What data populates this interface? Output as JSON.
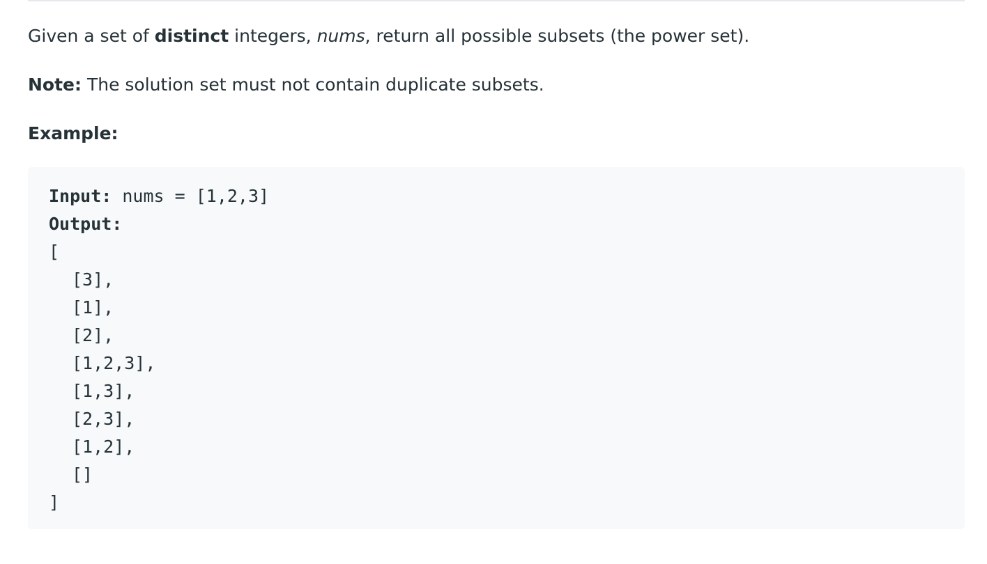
{
  "description": {
    "p1": {
      "prefix": "Given a set of ",
      "bold": "distinct",
      "middle": " integers, ",
      "italic": "nums",
      "suffix": ", return all possible subsets (the power set)."
    },
    "note": {
      "label": "Note:",
      "text": " The solution set must not contain duplicate subsets."
    },
    "example_heading": "Example:"
  },
  "example": {
    "input_label": "Input:",
    "input_value": " nums = [1,2,3]",
    "output_label": "Output:",
    "open_bracket": "[",
    "items": [
      "[3],",
      "[1],",
      "[2],",
      "[1,2,3],",
      "[1,3],",
      "[2,3],",
      "[1,2],",
      "[]"
    ],
    "close_bracket": "]"
  }
}
